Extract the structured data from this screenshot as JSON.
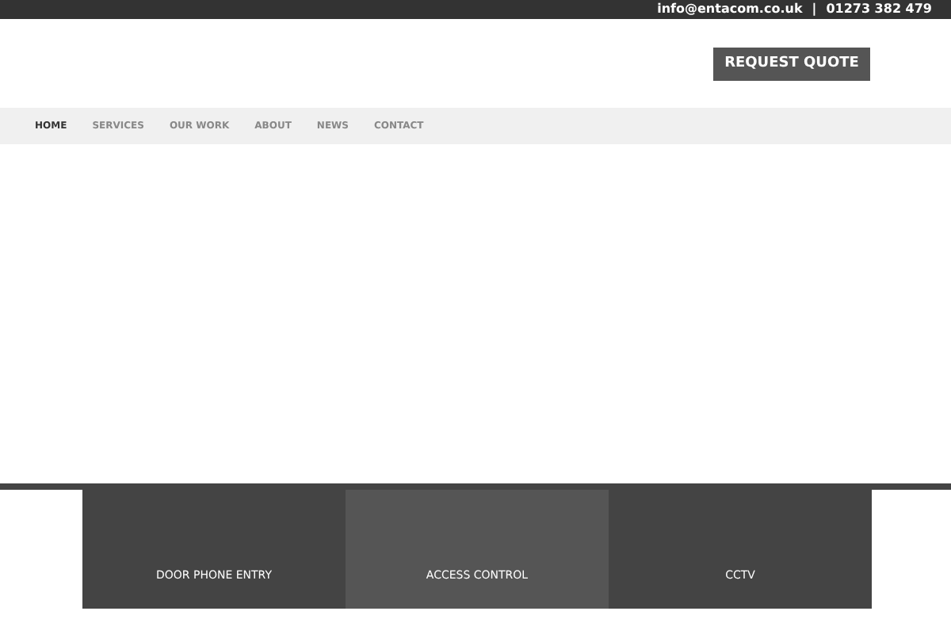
{
  "top_bar": {
    "email": "info@entacom.co.uk",
    "separator": "|",
    "phone": "01273 382 479"
  },
  "header": {
    "button": "REQUEST QUOTE"
  },
  "nav": [
    {
      "label": "HOME",
      "selected": true
    },
    {
      "label": "SERVICES",
      "selected": false
    },
    {
      "label": "OUR WORK",
      "selected": false
    },
    {
      "label": "ABOUT",
      "selected": false
    },
    {
      "label": "NEWS",
      "selected": false
    },
    {
      "label": "CONTACT",
      "selected": false
    }
  ],
  "services": [
    {
      "label": "DOOR PHONE ENTRY",
      "selected": false
    },
    {
      "label": "ACCESS CONTROL",
      "selected": true
    },
    {
      "label": "CCTV",
      "selected": false
    }
  ]
}
